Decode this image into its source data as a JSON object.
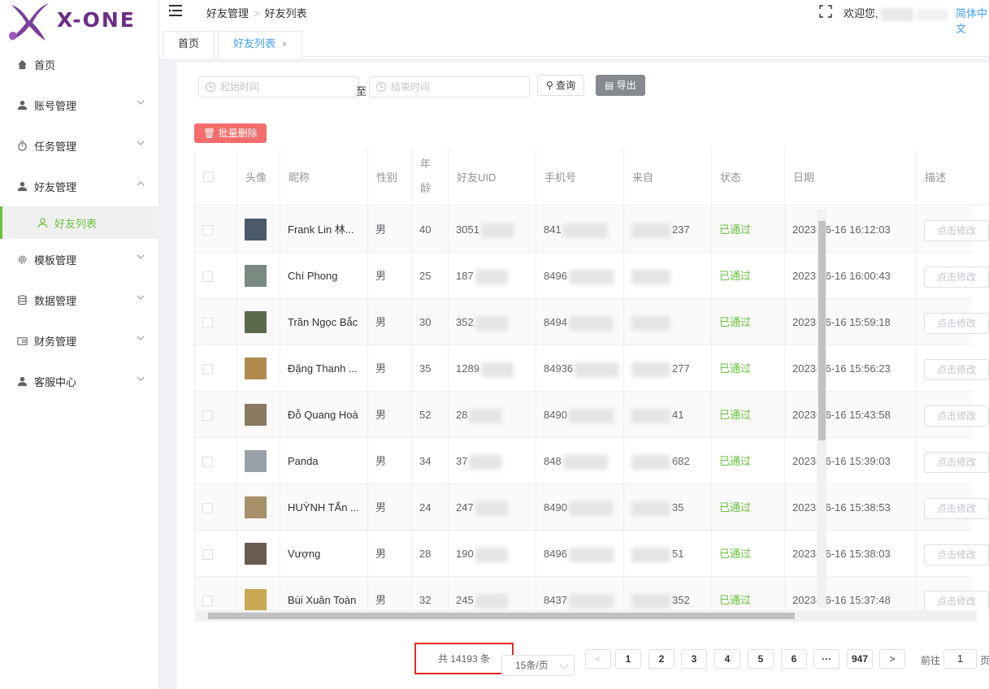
{
  "app": {
    "logo_text": "X-ONE"
  },
  "sidebar": {
    "items": [
      {
        "label": "首页",
        "icon": "home-icon"
      },
      {
        "label": "账号管理",
        "icon": "user-icon",
        "arrow": "chevron-down-icon"
      },
      {
        "label": "任务管理",
        "icon": "timer-icon",
        "arrow": "chevron-down-icon"
      },
      {
        "label": "好友管理",
        "icon": "user-icon",
        "arrow": "chevron-up-icon"
      },
      {
        "label": "好友列表",
        "icon": "user-outline-icon",
        "active": true
      },
      {
        "label": "模板管理",
        "icon": "gear-icon",
        "arrow": "chevron-down-icon"
      },
      {
        "label": "数据管理",
        "icon": "database-icon",
        "arrow": "chevron-down-icon"
      },
      {
        "label": "财务管理",
        "icon": "wallet-icon",
        "arrow": "chevron-down-icon"
      },
      {
        "label": "客服中心",
        "icon": "user-icon",
        "arrow": "chevron-down-icon"
      }
    ]
  },
  "header": {
    "breadcrumb": [
      "好友管理",
      "好友列表"
    ],
    "welcome": "欢迎您,",
    "language": "简体中文"
  },
  "tabs": [
    {
      "label": "首页"
    },
    {
      "label": "好友列表",
      "close": "×"
    }
  ],
  "filters": {
    "start_placeholder": "起始时间",
    "to_label": "至",
    "end_placeholder": "结束时间",
    "query_label": "查询",
    "export_label": "导出",
    "batch_delete_label": "批量删除"
  },
  "table": {
    "columns": [
      "头像",
      "昵称",
      "性别",
      "年\n龄",
      "好友UID",
      "手机号",
      "来自",
      "状态",
      "日期",
      "描述"
    ],
    "rows": [
      {
        "nickname": "Frank Lin 林...",
        "gender": "男",
        "age": "40",
        "uid": "3051",
        "phone": "841",
        "from": "237",
        "status": "已通过",
        "date": "2023-06-16 16:12:03",
        "desc": "点击修改",
        "avatar_color": "#4a5a6a"
      },
      {
        "nickname": "Chí Phong",
        "gender": "男",
        "age": "25",
        "uid": "187",
        "phone": "8496",
        "from": "",
        "status": "已通过",
        "date": "2023-06-16 16:00:43",
        "desc": "点击修改",
        "avatar_color": "#7a8a80"
      },
      {
        "nickname": "Trần Ngọc Bắc",
        "gender": "男",
        "age": "30",
        "uid": "352",
        "phone": "8494",
        "from": "",
        "status": "已通过",
        "date": "2023-06-16 15:59:18",
        "desc": "点击修改",
        "avatar_color": "#5a6a4a"
      },
      {
        "nickname": "Đặng Thanh ...",
        "gender": "男",
        "age": "35",
        "uid": "1289",
        "phone": "84936",
        "from": "277",
        "status": "已通过",
        "date": "2023-06-16 15:56:23",
        "desc": "点击修改",
        "avatar_color": "#b08a50"
      },
      {
        "nickname": "Đỗ Quang Hoà",
        "gender": "男",
        "age": "52",
        "uid": "28",
        "phone": "8490",
        "from": "41",
        "status": "已通过",
        "date": "2023-06-16 15:43:58",
        "desc": "点击修改",
        "avatar_color": "#8a7a60"
      },
      {
        "nickname": "Panda",
        "gender": "男",
        "age": "34",
        "uid": "37",
        "phone": "848",
        "from": "682",
        "status": "已通过",
        "date": "2023-06-16 15:39:03",
        "desc": "点击修改",
        "avatar_color": "#9aa0a8"
      },
      {
        "nickname": "HUỲNH TẤn ...",
        "gender": "男",
        "age": "24",
        "uid": "247",
        "phone": "8490",
        "from": "35",
        "status": "已通过",
        "date": "2023-06-16 15:38:53",
        "desc": "点击修改",
        "avatar_color": "#a8906a"
      },
      {
        "nickname": "Vượng",
        "gender": "男",
        "age": "28",
        "uid": "190",
        "phone": "8496",
        "from": "51",
        "status": "已通过",
        "date": "2023-06-16 15:38:03",
        "desc": "点击修改",
        "avatar_color": "#6a5a50"
      },
      {
        "nickname": "Bùi Xuân Toàn",
        "gender": "男",
        "age": "32",
        "uid": "245",
        "phone": "8437",
        "from": "352",
        "status": "已通过",
        "date": "2023-06-16 15:37:48",
        "desc": "点击修改",
        "avatar_color": "#c8a850"
      }
    ]
  },
  "pagination": {
    "total": "共 14193 条",
    "page_size": "15条/页",
    "pages": [
      "1",
      "2",
      "3",
      "4",
      "5",
      "6",
      "···",
      "947"
    ],
    "goto_label": "前往",
    "goto_value": "1",
    "page_suffix": "页"
  }
}
